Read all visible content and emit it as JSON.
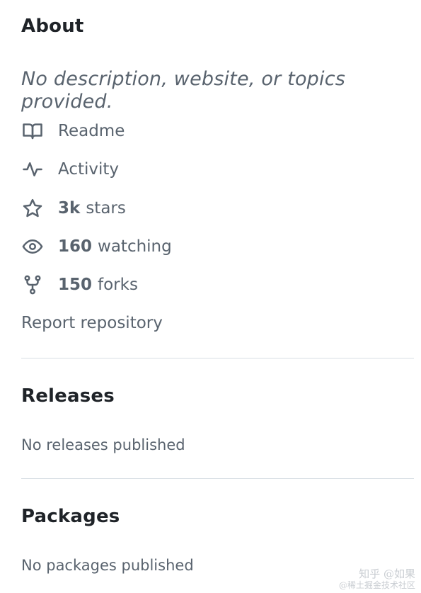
{
  "about": {
    "title": "About",
    "description": "No description, website, or topics provided.",
    "items": [
      {
        "icon": "book-icon",
        "count": "",
        "label": "Readme"
      },
      {
        "icon": "pulse-icon",
        "count": "",
        "label": "Activity"
      },
      {
        "icon": "star-icon",
        "count": "3k",
        "label": "stars"
      },
      {
        "icon": "eye-icon",
        "count": "160",
        "label": "watching"
      },
      {
        "icon": "fork-icon",
        "count": "150",
        "label": "forks"
      }
    ],
    "report_label": "Report repository"
  },
  "releases": {
    "title": "Releases",
    "empty_text": "No releases published"
  },
  "packages": {
    "title": "Packages",
    "empty_text": "No packages published"
  },
  "watermark": {
    "line1": "知乎 @如果",
    "line2": "@稀土掘金技术社区"
  },
  "colors": {
    "heading": "#1f2328",
    "muted": "#59636e",
    "divider": "#d8dee4"
  }
}
